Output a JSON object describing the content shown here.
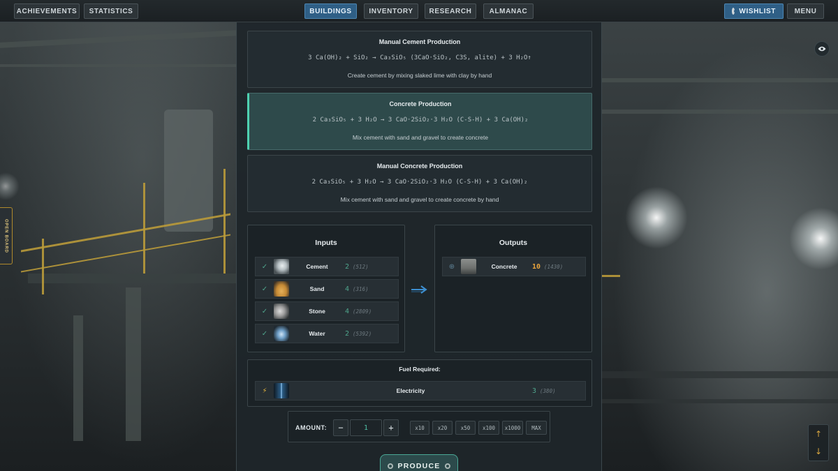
{
  "nav": {
    "left": [
      "ACHIEVEMENTS",
      "STATISTICS"
    ],
    "center": [
      "BUILDINGS",
      "INVENTORY",
      "RESEARCH",
      "ALMANAC"
    ],
    "active": "BUILDINGS",
    "wishlist": "WISHLIST",
    "menu": "MENU"
  },
  "side_tab": "OPEN BOARD",
  "recipes": [
    {
      "title": "Manual Cement Production",
      "formula": "3 Ca(OH)₂ + SiO₂ → Ca₃SiO₅ (3CaO·SiO₂, C3S, alite) + 3 H₂O↑",
      "description": "Create cement by mixing slaked lime with clay by hand",
      "selected": false
    },
    {
      "title": "Concrete Production",
      "formula": "2 Ca₃SiO₅ + 3 H₂O → 3 CaO·2SiO₂·3 H₂O (C-S-H) + 3 Ca(OH)₂",
      "description": "Mix cement with sand and gravel to create concrete",
      "selected": true
    },
    {
      "title": "Manual Concrete Production",
      "formula": "2 Ca₃SiO₅ + 3 H₂O → 3 CaO·2SiO₂·3 H₂O (C-S-H) + 3 Ca(OH)₂",
      "description": "Mix cement with sand and gravel to create concrete by hand",
      "selected": false
    }
  ],
  "inputs": {
    "title": "Inputs",
    "items": [
      {
        "name": "Cement",
        "qty": "2",
        "stock": "(512)",
        "icon": "cement-icon"
      },
      {
        "name": "Sand",
        "qty": "4",
        "stock": "(316)",
        "icon": "sand-icon"
      },
      {
        "name": "Stone",
        "qty": "4",
        "stock": "(2809)",
        "icon": "stone-icon"
      },
      {
        "name": "Water",
        "qty": "2",
        "stock": "(5392)",
        "icon": "water-icon"
      }
    ]
  },
  "outputs": {
    "title": "Outputs",
    "items": [
      {
        "name": "Concrete",
        "qty": "10",
        "stock": "(1430)",
        "icon": "concrete-icon"
      }
    ]
  },
  "fuel": {
    "title": "Fuel Required:",
    "name": "Electricity",
    "qty": "3",
    "stock": "(380)",
    "icon": "electricity-icon"
  },
  "amount": {
    "label": "AMOUNT:",
    "minus": "−",
    "value": "1",
    "plus": "+",
    "presets": [
      "x10",
      "x20",
      "x50",
      "x100",
      "x1000",
      "MAX"
    ]
  },
  "produce": "PRODUCE",
  "colors": {
    "accent": "#4ed0b0",
    "active_tab": "#2f5f86",
    "qty_green": "#4fa58c",
    "output_qty": "#e9a43c"
  }
}
